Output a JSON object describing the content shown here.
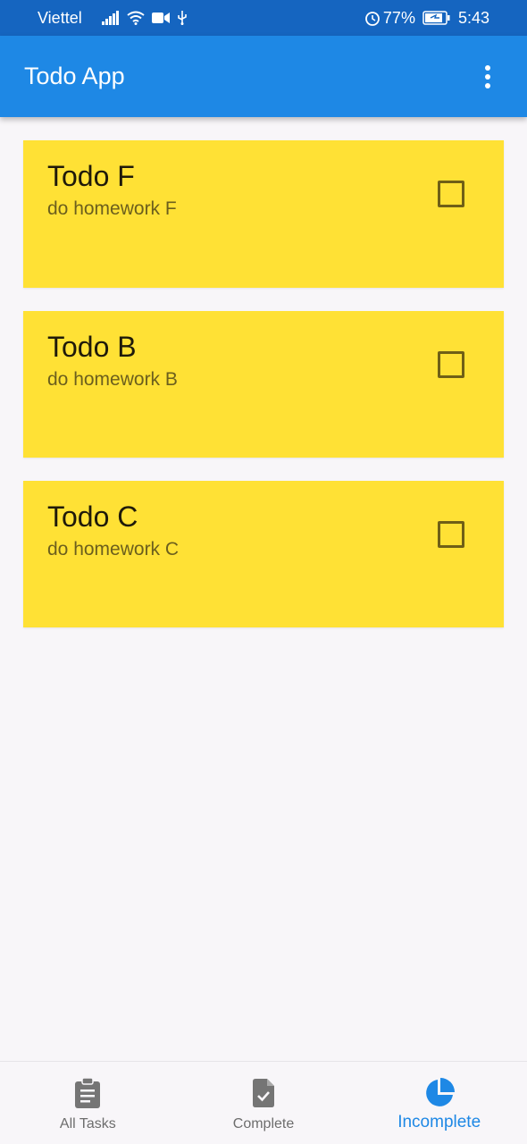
{
  "status_bar": {
    "carrier": "Viettel",
    "battery": "77%",
    "time": "5:43"
  },
  "app_bar": {
    "title": "Todo App",
    "menu_icon": "more-vert-icon"
  },
  "todos": [
    {
      "title": "Todo F",
      "description": "do homework F",
      "completed": false
    },
    {
      "title": "Todo B",
      "description": "do homework B",
      "completed": false
    },
    {
      "title": "Todo C",
      "description": "do homework C",
      "completed": false
    }
  ],
  "bottom_nav": {
    "items": [
      {
        "label": "All Tasks",
        "icon": "clipboard-list-icon",
        "active": false
      },
      {
        "label": "Complete",
        "icon": "document-check-icon",
        "active": false
      },
      {
        "label": "Incomplete",
        "icon": "pie-chart-icon",
        "active": true
      }
    ]
  },
  "colors": {
    "status_bar": "#1565c0",
    "app_bar": "#1e88e5",
    "card": "#ffe135",
    "active_nav": "#1e88e5",
    "inactive_nav": "#6d6d6d",
    "background": "#f8f6f9"
  }
}
